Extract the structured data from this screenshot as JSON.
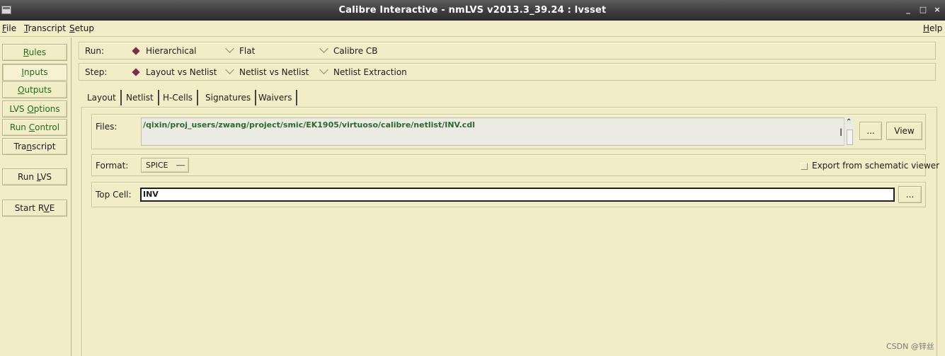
{
  "window": {
    "title": "Calibre Interactive - nmLVS v2013.3_39.24 : lvsset",
    "min": "_",
    "max": "□",
    "close": "×"
  },
  "menubar": {
    "file_u": "F",
    "file_rest": "ile",
    "transcript_u": "T",
    "transcript_rest": "ranscript",
    "setup_u": "S",
    "setup_rest": "etup",
    "help_u": "H",
    "help_rest": "elp"
  },
  "sidebar": {
    "rules_u": "R",
    "rules_rest": "ules",
    "inputs_u": "I",
    "inputs_rest": "nputs",
    "outputs_u": "O",
    "outputs_rest": "utputs",
    "lvs_a": "LVS ",
    "lvs_u": "O",
    "lvs_b": "ptions",
    "run_a": "Run ",
    "run_u": "C",
    "run_b": "ontrol",
    "tr_a": "Tra",
    "tr_u": "n",
    "tr_b": "script",
    "runlvs_a": "Run ",
    "runlvs_u": "L",
    "runlvs_b": "VS",
    "rve_a": "Start R",
    "rve_u": "V",
    "rve_b": "E"
  },
  "run_row": {
    "label": "Run:",
    "options": [
      "Hierarchical",
      "Flat",
      "Calibre CB"
    ],
    "selected": "Hierarchical"
  },
  "step_row": {
    "label": "Step:",
    "options": [
      "Layout vs Netlist",
      "Netlist vs Netlist",
      "Netlist Extraction"
    ],
    "selected": "Layout vs Netlist"
  },
  "tabs": [
    "Layout",
    "Netlist",
    "H-Cells",
    "Signatures",
    "Waivers"
  ],
  "active_tab": "Netlist",
  "files": {
    "label": "Files:",
    "value": "/qixin/proj_users/zwang/project/smic/EK1905/virtuoso/calibre/netlist/INV.cdl",
    "browse": "...",
    "view": "View"
  },
  "format": {
    "label": "Format:",
    "value": "SPICE",
    "export_label": "Export from schematic viewer",
    "export_checked": false
  },
  "topcell": {
    "label": "Top Cell:",
    "value": "INV",
    "browse": "..."
  },
  "watermark": "CSDN @锌丝",
  "colors": {
    "background": "#f1edc6",
    "accent_text": "#1f6b1f",
    "radio_selected": "#7a2e4e",
    "titlebar": "#3e3e3e"
  }
}
